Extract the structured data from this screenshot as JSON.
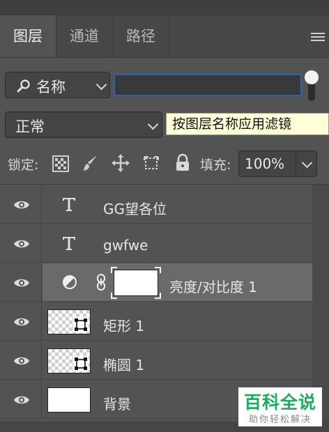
{
  "tabs": [
    {
      "label": "图层",
      "active": true
    },
    {
      "label": "通道",
      "active": false
    },
    {
      "label": "路径",
      "active": false
    }
  ],
  "filter": {
    "type_label": "名称",
    "search_value": "",
    "tooltip": "按图层名称应用滤镜"
  },
  "blend_mode": "正常",
  "lock": {
    "label": "锁定:",
    "icons": [
      "transparency-lock-icon",
      "paint-brush-icon",
      "move-icon",
      "artboard-icon",
      "padlock-icon"
    ]
  },
  "fill": {
    "label": "填充:",
    "value": "100%"
  },
  "layers": [
    {
      "name": "GG望各位",
      "type": "text",
      "icon": "text-layer-icon",
      "visible": true,
      "selected": false
    },
    {
      "name": "gwfwe",
      "type": "text",
      "icon": "text-layer-icon",
      "visible": true,
      "selected": false
    },
    {
      "name": "亮度/对比度 1",
      "type": "adjustment",
      "icon": "adjustment-layer-icon",
      "visible": true,
      "selected": true
    },
    {
      "name": "矩形 1",
      "type": "shape",
      "icon": "shape-layer-icon",
      "visible": true,
      "selected": false
    },
    {
      "name": "椭圆 1",
      "type": "shape",
      "icon": "shape-layer-icon",
      "visible": true,
      "selected": false
    },
    {
      "name": "背景",
      "type": "background",
      "icon": "",
      "visible": true,
      "selected": false
    }
  ],
  "watermark": {
    "title": "百科全说",
    "subtitle": "助你轻松解决"
  },
  "colors": {
    "panel_bg": "#535353",
    "selected_row": "#6a6a6a",
    "tooltip_bg": "#ffffd8",
    "focus_border": "#2b63b8",
    "watermark_green": "#1aaf5d"
  }
}
